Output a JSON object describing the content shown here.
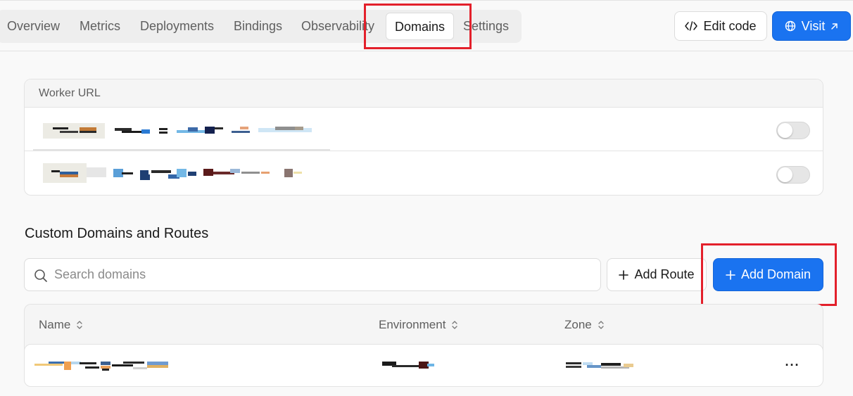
{
  "header": {
    "tabs": [
      {
        "label": "Overview"
      },
      {
        "label": "Metrics"
      },
      {
        "label": "Deployments"
      },
      {
        "label": "Bindings"
      },
      {
        "label": "Observability"
      },
      {
        "label": "Domains",
        "active": true
      },
      {
        "label": "Settings"
      }
    ],
    "edit_code_label": "Edit code",
    "visit_label": "Visit"
  },
  "worker_url": {
    "title": "Worker URL",
    "rows": [
      {
        "enabled": false
      },
      {
        "enabled": false
      }
    ]
  },
  "custom_domains": {
    "title": "Custom Domains and Routes",
    "search_placeholder": "Search domains",
    "add_route_label": "Add Route",
    "add_domain_label": "Add Domain",
    "columns": [
      "Name",
      "Environment",
      "Zone"
    ],
    "rows": [
      {
        "actions_label": "···"
      }
    ]
  },
  "colors": {
    "accent": "#1a73f0",
    "highlight": "#e3202b"
  }
}
